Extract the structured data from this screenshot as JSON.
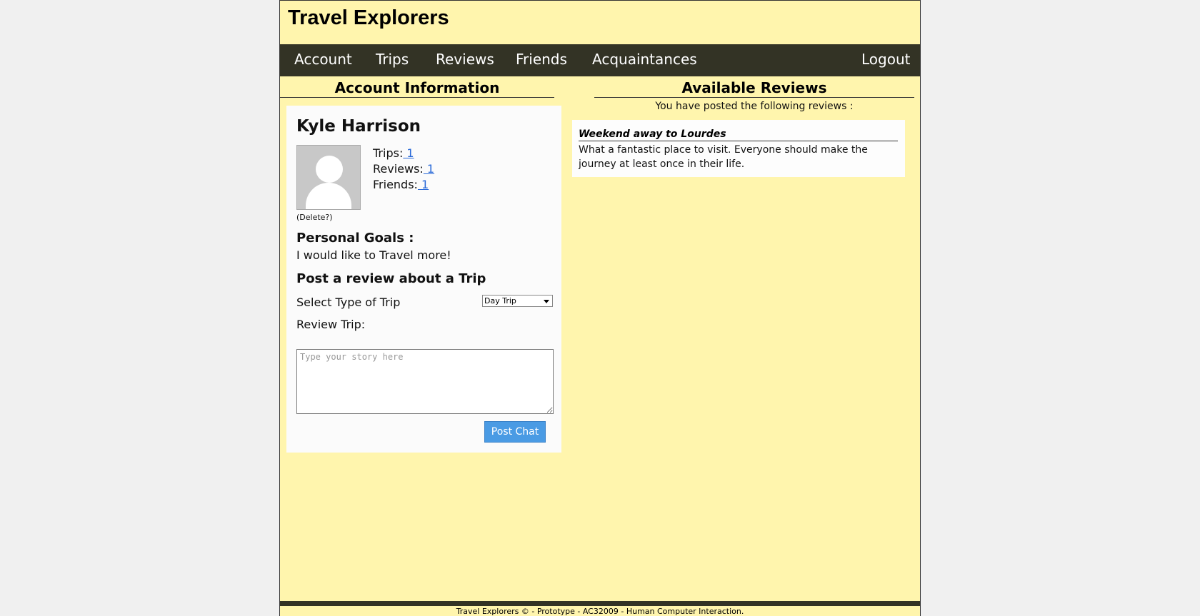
{
  "site": {
    "title": "Travel Explorers"
  },
  "nav": {
    "items": [
      {
        "label": "Account"
      },
      {
        "label": "Trips"
      },
      {
        "label": "Reviews"
      },
      {
        "label": "Friends"
      },
      {
        "label": "Acquaintances"
      }
    ],
    "logout": "Logout"
  },
  "account": {
    "heading": "Account Information",
    "name": "Kyle Harrison",
    "avatar_icon": "user-silhouette-icon",
    "stats": {
      "trips_label": "Trips:",
      "trips_value": " 1",
      "reviews_label": "Reviews:",
      "reviews_value": " 1",
      "friends_label": "Friends:",
      "friends_value": " 1"
    },
    "delete_label": "(Delete?)",
    "goals_heading": "Personal Goals :",
    "goals_text": "I would like to Travel more!",
    "post_heading": "Post a review about a Trip",
    "select_label": "Select Type of Trip",
    "select_value": "Day Trip",
    "review_label": "Review Trip:",
    "story_placeholder": "Type your story here",
    "post_button": "Post Chat"
  },
  "reviews": {
    "heading": "Available Reviews",
    "intro": "You have posted the following reviews :",
    "items": [
      {
        "title": "Weekend away to Lourdes",
        "body": "What a fantastic place to visit. Everyone should make the journey at least once in their life."
      }
    ]
  },
  "footer": {
    "text": "Travel Explorers © - Prototype - AC32009 - Human Computer Interaction."
  },
  "colors": {
    "page_background": "#fff5ad",
    "nav_background": "#333325",
    "button_blue": "#4a9be4",
    "link_blue": "#2a6ad8"
  }
}
